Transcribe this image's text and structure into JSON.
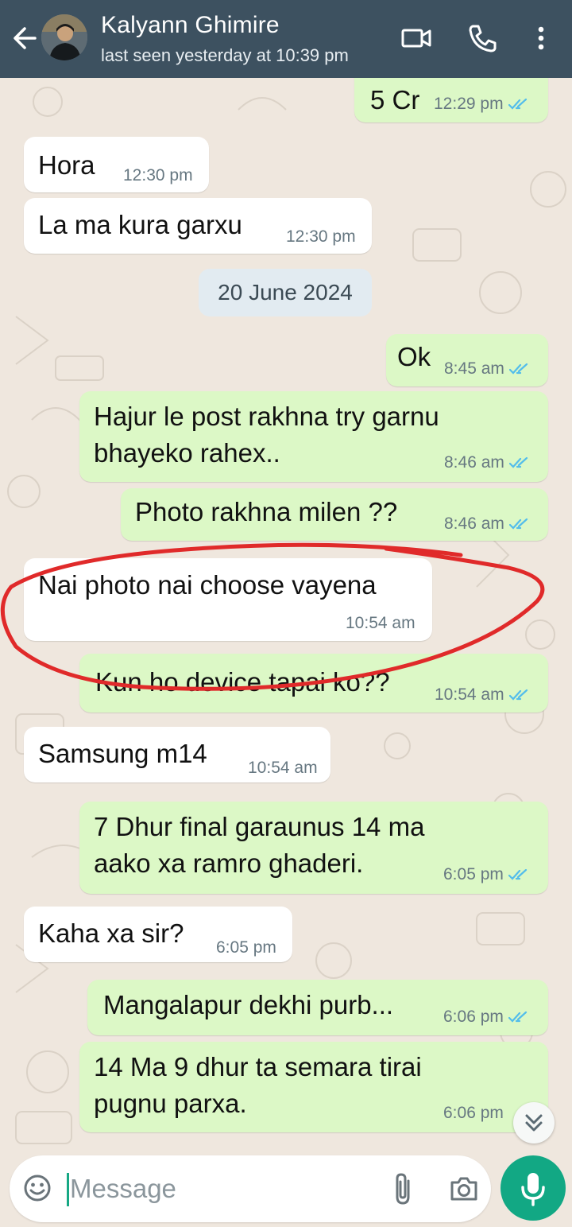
{
  "header": {
    "contact_name": "Kalyann Ghimire",
    "last_seen": "last seen yesterday at 10:39 pm"
  },
  "messages": [
    {
      "direction": "out",
      "text": "5 Cr",
      "time": "12:29 pm",
      "read": true
    },
    {
      "direction": "in",
      "text": "Hora",
      "time": "12:30 pm"
    },
    {
      "direction": "in",
      "text": "La ma kura garxu",
      "time": "12:30 pm"
    },
    {
      "direction": "out",
      "text": "Ok",
      "time": "8:45 am",
      "read": true
    },
    {
      "direction": "out",
      "text_lines": [
        "Hajur le post rakhna try garnu",
        "bhayeko rahex.."
      ],
      "time": "8:46 am",
      "read": true
    },
    {
      "direction": "out",
      "text": "Photo rakhna milen ??",
      "time": "8:46 am",
      "read": true
    },
    {
      "direction": "in",
      "text": "Nai photo nai choose vayena",
      "time": "10:54 am",
      "highlighted": true
    },
    {
      "direction": "out",
      "text": "Kun ho device tapai ko??",
      "time": "10:54 am",
      "read": true
    },
    {
      "direction": "in",
      "text": "Samsung m14",
      "time": "10:54 am"
    },
    {
      "direction": "out",
      "text_lines": [
        "7 Dhur final garaunus 14 ma",
        "aako xa ramro ghaderi."
      ],
      "time": "6:05 pm",
      "read": true
    },
    {
      "direction": "in",
      "text": "Kaha xa sir?",
      "time": "6:05 pm"
    },
    {
      "direction": "out",
      "text": "Mangalapur dekhi purb...",
      "time": "6:06 pm",
      "read": true
    },
    {
      "direction": "out",
      "text_lines": [
        "14 Ma 9 dhur ta semara tirai",
        "pugnu parxa."
      ],
      "time": "6:06 pm",
      "read": true
    }
  ],
  "date_divider": "20 June 2024",
  "composer": {
    "placeholder": "Message"
  },
  "icons": {
    "back": "arrow-left-icon",
    "video": "video-call-icon",
    "call": "phone-icon",
    "menu": "more-vert-icon",
    "emoji": "emoji-icon",
    "attach": "paperclip-icon",
    "camera": "camera-icon",
    "mic": "mic-icon",
    "scroll": "double-chevron-down-icon"
  },
  "colors": {
    "header_bg": "#3d5160",
    "incoming_bubble": "#ffffff",
    "outgoing_bubble": "#dcf8c6",
    "read_tick": "#53bdeb",
    "mic_button": "#12a884",
    "annotation_circle": "#e02a2a"
  }
}
